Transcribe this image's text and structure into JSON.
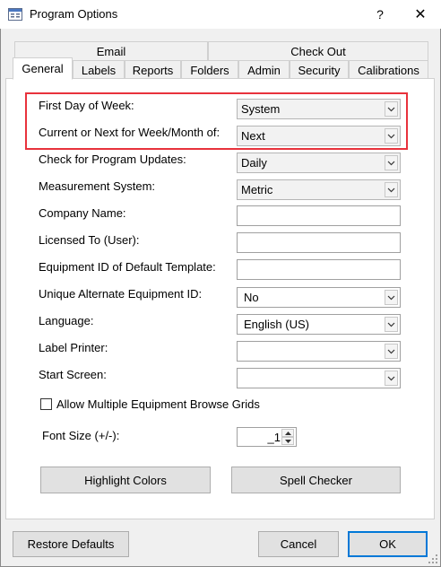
{
  "window": {
    "title": "Program Options",
    "help_label": "?",
    "close_label": "✕"
  },
  "tabs": {
    "row1": [
      {
        "label": "Email"
      },
      {
        "label": "Check Out"
      }
    ],
    "row2": [
      {
        "label": "General"
      },
      {
        "label": "Labels"
      },
      {
        "label": "Reports"
      },
      {
        "label": "Folders"
      },
      {
        "label": "Admin"
      },
      {
        "label": "Security"
      },
      {
        "label": "Calibrations"
      }
    ],
    "active": "General"
  },
  "form": {
    "first_day_of_week": {
      "label": "First Day of Week:",
      "value": "System"
    },
    "current_or_next": {
      "label": "Current or Next for Week/Month of:",
      "value": "Next"
    },
    "check_updates": {
      "label": "Check for Program Updates:",
      "value": "Daily"
    },
    "measurement_system": {
      "label": "Measurement System:",
      "value": "Metric"
    },
    "company_name": {
      "label": "Company Name:",
      "value": ""
    },
    "licensed_to": {
      "label": "Licensed To (User):",
      "value": ""
    },
    "equipment_id_template": {
      "label": "Equipment ID of Default Template:",
      "value": ""
    },
    "unique_alt_equipment_id": {
      "label": "Unique Alternate Equipment ID:",
      "value": "No"
    },
    "language": {
      "label": "Language:",
      "value": "English (US)"
    },
    "label_printer": {
      "label": "Label Printer:",
      "value": ""
    },
    "start_screen": {
      "label": "Start Screen:",
      "value": ""
    },
    "allow_multiple_grids": {
      "label": "Allow Multiple Equipment Browse Grids",
      "checked": false
    },
    "font_size": {
      "label": "Font Size (+/-):",
      "value": "_1"
    }
  },
  "buttons": {
    "highlight_colors": "Highlight Colors",
    "spell_checker": "Spell Checker",
    "restore_defaults": "Restore Defaults",
    "cancel": "Cancel",
    "ok": "OK"
  },
  "colors": {
    "highlight_border": "#e8323c",
    "default_button_border": "#0078d7"
  },
  "icons": {
    "app": "program-options-icon",
    "dropdown": "chevron-down-icon",
    "spin_up": "spin-up-icon",
    "spin_down": "spin-down-icon",
    "grip": "resize-grip-icon"
  }
}
